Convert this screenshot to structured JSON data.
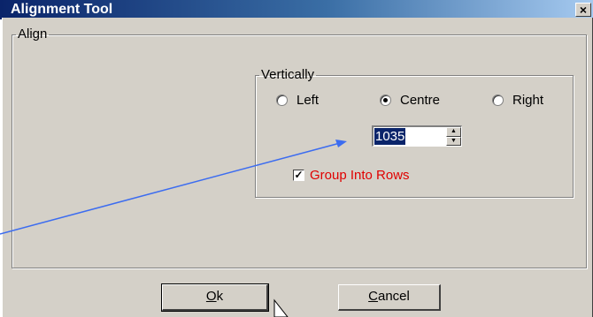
{
  "window": {
    "title": "Alignment Tool",
    "close_label": "×"
  },
  "align_group": {
    "legend": "Align"
  },
  "vertical_group": {
    "legend": "Vertically",
    "options": [
      {
        "label": "Left",
        "selected": false
      },
      {
        "label": "Centre",
        "selected": true
      },
      {
        "label": "Right",
        "selected": false
      }
    ]
  },
  "spin_input": {
    "value": "1035"
  },
  "group_rows": {
    "label": "Group Into Rows",
    "checked": true,
    "label_color": "#e00000"
  },
  "buttons": {
    "ok": {
      "mnemonic": "O",
      "rest": "k"
    },
    "cancel": {
      "mnemonic": "C",
      "rest": "ancel"
    }
  },
  "colors": {
    "arrow": "#3c6cf0",
    "dialog_bg": "#d4d0c8",
    "selection": "#0a246a"
  }
}
